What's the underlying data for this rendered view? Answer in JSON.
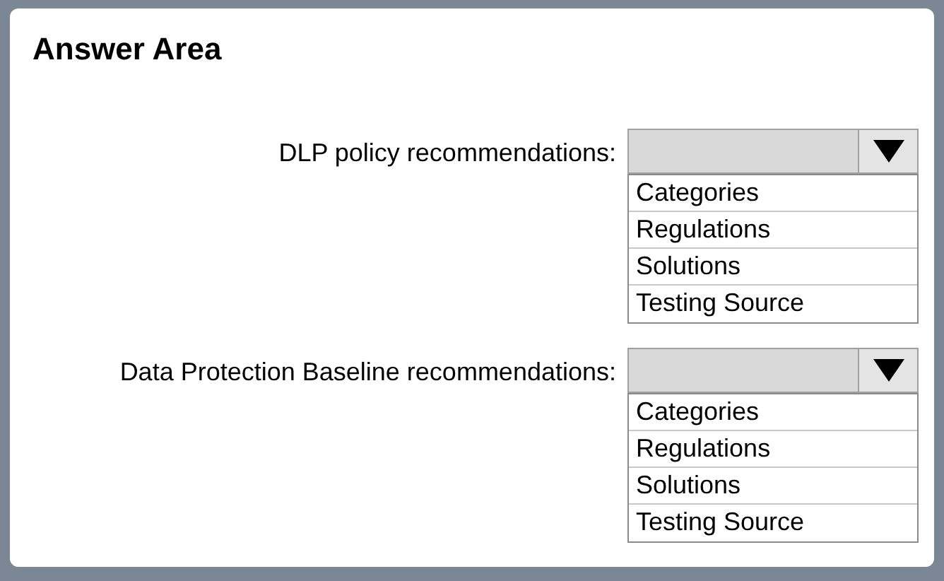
{
  "title": "Answer Area",
  "questions": [
    {
      "label": "DLP policy recommendations:",
      "options": [
        "Categories",
        "Regulations",
        "Solutions",
        "Testing Source"
      ]
    },
    {
      "label": "Data Protection Baseline recommendations:",
      "options": [
        "Categories",
        "Regulations",
        "Solutions",
        "Testing Source"
      ]
    }
  ]
}
